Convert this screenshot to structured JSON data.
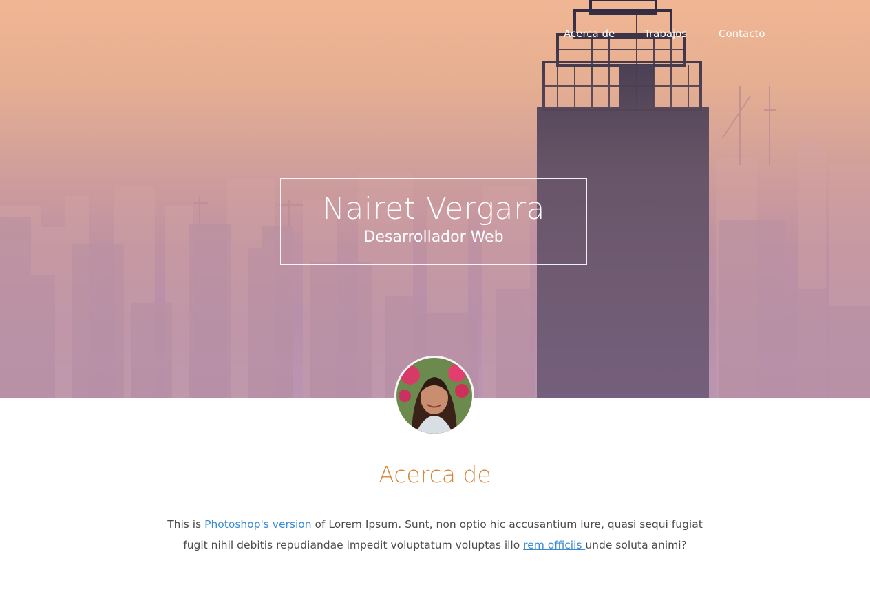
{
  "nav": {
    "items": [
      "Acerca de",
      "Trabajos",
      "Contacto"
    ]
  },
  "hero": {
    "name": "Nairet Vergara",
    "role": "Desarrollador Web"
  },
  "about": {
    "title": "Acerca de",
    "text_1": "This is ",
    "link_1": "Photoshop's version",
    "text_2": " of Lorem Ipsum. Sunt, non optio hic accusantium iure, quasi sequi fugiat fugit nihil debitis repudiandae impedit voluptatum voluptas illo ",
    "link_2": "rem officiis ",
    "text_3": "unde soluta animi?"
  },
  "colors": {
    "accent": "#d4863a",
    "link": "#3a8bd6",
    "body_text": "#4b4b4b"
  }
}
